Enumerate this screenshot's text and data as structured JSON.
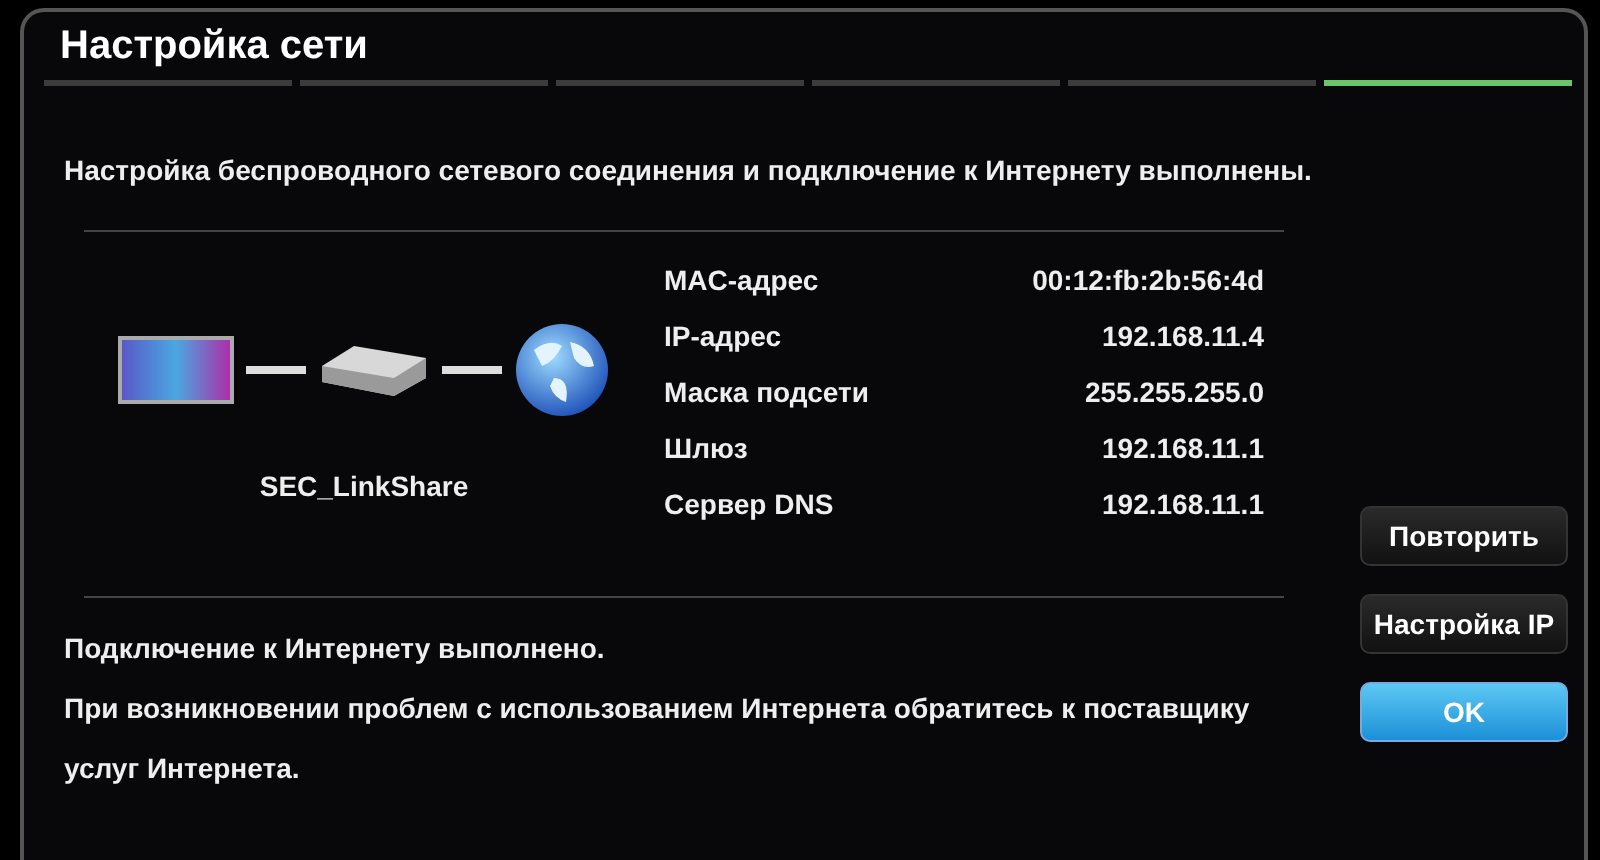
{
  "window": {
    "title": "Настройка сети"
  },
  "steps": [
    {
      "selected": false
    },
    {
      "selected": false
    },
    {
      "selected": false
    },
    {
      "selected": false
    },
    {
      "selected": false
    },
    {
      "selected": true
    }
  ],
  "message": "Настройка беспроводного сетевого соединения и подключение к Интернету выполнены.",
  "network_name": "SEC_LinkShare",
  "details": [
    {
      "label": "MAC-адрес",
      "value": "00:12:fb:2b:56:4d"
    },
    {
      "label": "IP-адрес",
      "value": "192.168.11.4"
    },
    {
      "label": "Маска подсети",
      "value": "255.255.255.0"
    },
    {
      "label": "Шлюз",
      "value": "192.168.11.1"
    },
    {
      "label": "Сервер DNS",
      "value": "192.168.11.1"
    }
  ],
  "status": [
    "Подключение к Интернету выполнено.",
    "При возникновении проблем с использованием Интернета обратитесь к поставщику услуг Интернета."
  ],
  "buttons": [
    {
      "label": "Повторить",
      "selected": false
    },
    {
      "label": "Настройка IP",
      "selected": false
    },
    {
      "label": "OK",
      "selected": true
    }
  ]
}
